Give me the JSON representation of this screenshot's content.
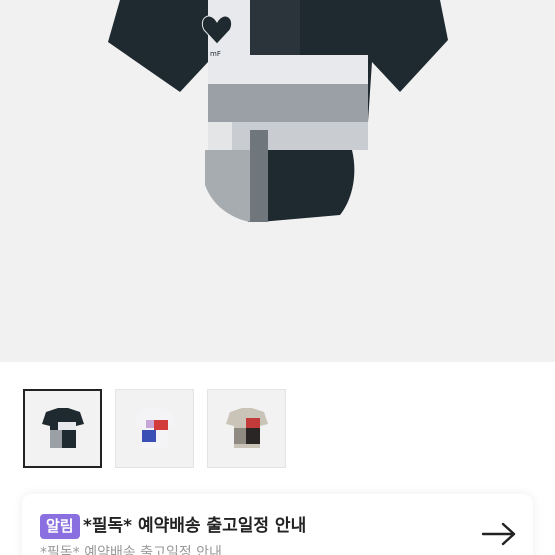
{
  "product": {
    "main_image_icon": "cropped-tshirt-black-gray-patchwork",
    "thumbnails": [
      {
        "icon": "tshirt-black-gray",
        "selected": true
      },
      {
        "icon": "tshirt-white-red-blue",
        "selected": false
      },
      {
        "icon": "tshirt-beige-red-black",
        "selected": false
      }
    ]
  },
  "notice": {
    "badge": "알림",
    "title": "*필독* 예약배송 출고일정 안내",
    "subtitle": "*필독* 예약배송 출고일정 안내",
    "arrow_icon": "arrow-right-icon"
  },
  "colors": {
    "badge": "#8a6fe0",
    "hero_bg": "#f1f1f1"
  }
}
